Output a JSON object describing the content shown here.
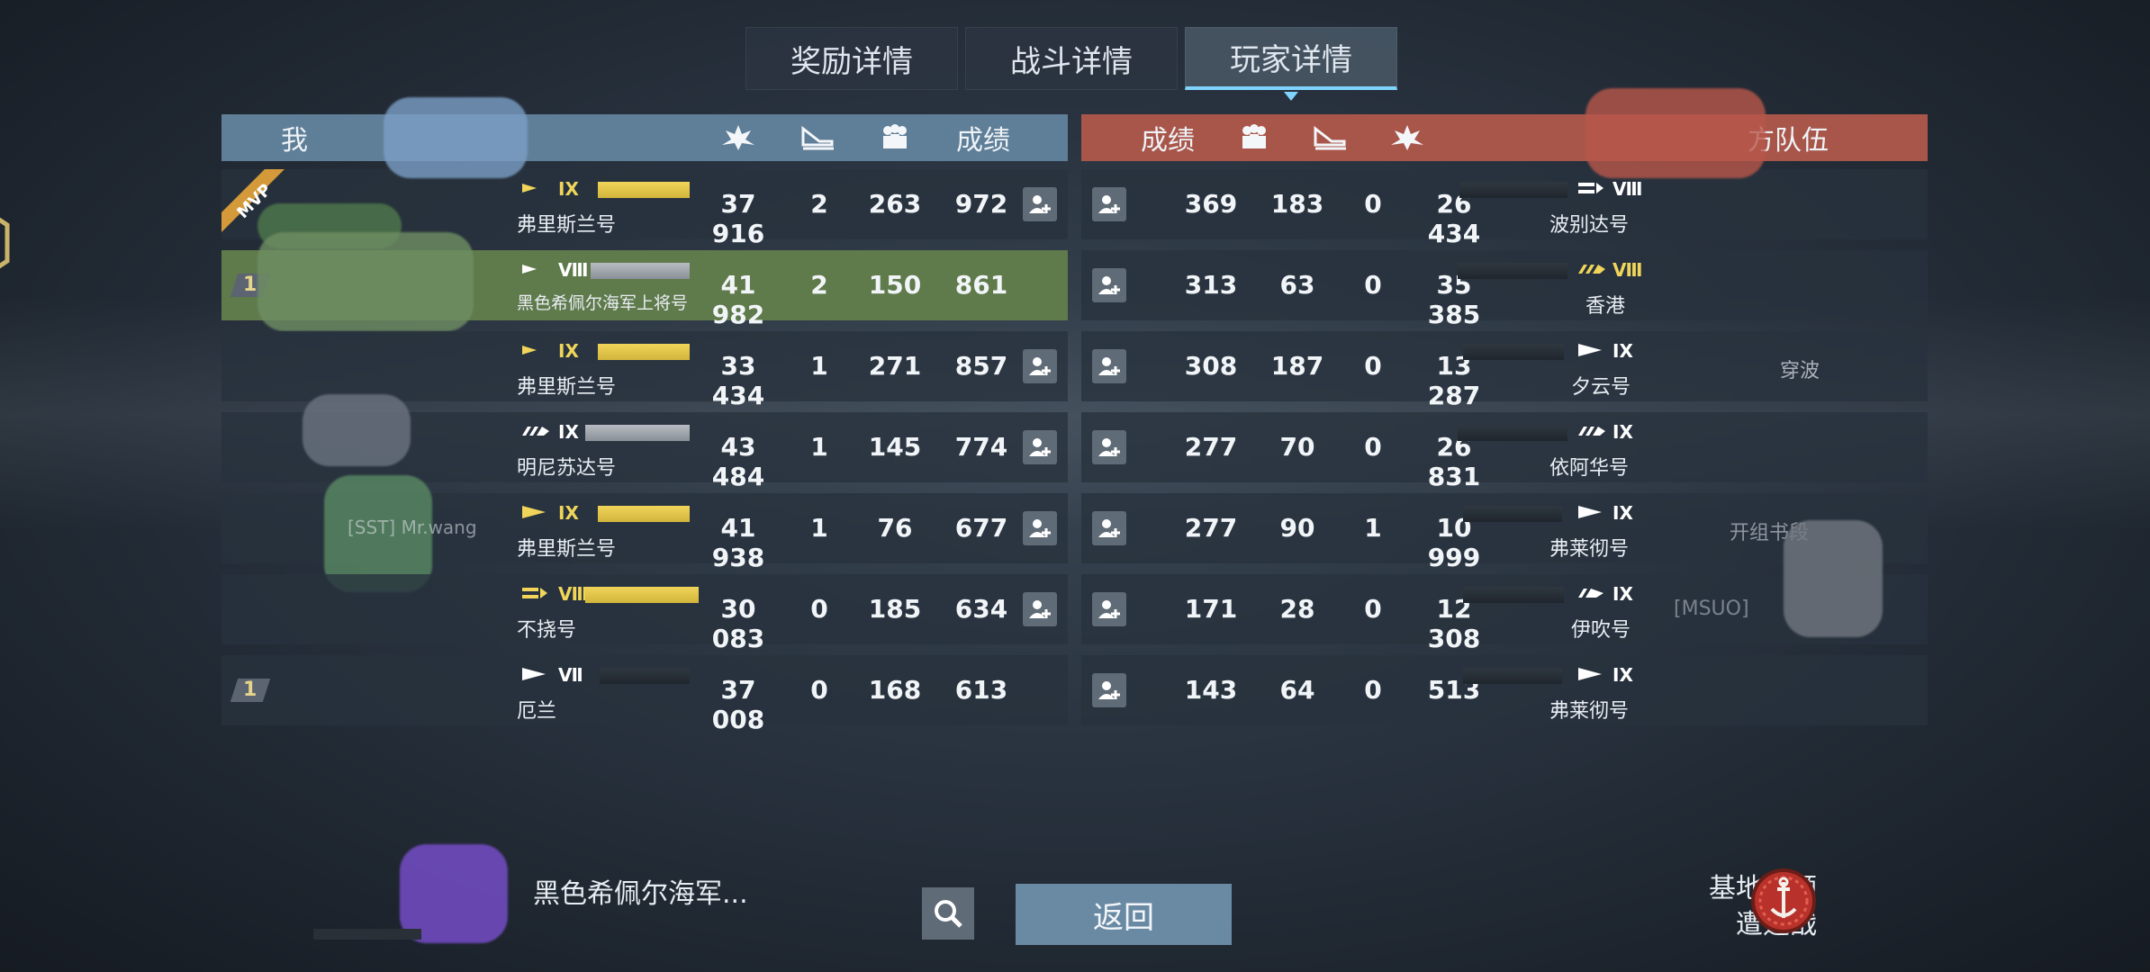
{
  "tabs": [
    {
      "label": "奖励详情"
    },
    {
      "label": "战斗详情"
    },
    {
      "label": "玩家详情"
    }
  ],
  "left_header": {
    "team_label": "我",
    "col_score": "成绩"
  },
  "right_header": {
    "team_label": "方队伍",
    "col_score": "成绩"
  },
  "left_rows": [
    {
      "tier": "IX",
      "ship": "弗里斯兰号",
      "damage": "37 916",
      "kills": "2",
      "assists": "263",
      "score": "972",
      "mvp": "MVP",
      "rank": "",
      "player": ""
    },
    {
      "tier": "Ⅷ",
      "ship": "黑色希佩尔海军上将号",
      "damage": "41 982",
      "kills": "2",
      "assists": "150",
      "score": "861",
      "rank": "1",
      "player": ""
    },
    {
      "tier": "IX",
      "ship": "弗里斯兰号",
      "damage": "33 434",
      "kills": "1",
      "assists": "271",
      "score": "857",
      "rank": "",
      "player": ""
    },
    {
      "tier": "IX",
      "ship": "明尼苏达号",
      "damage": "43 484",
      "kills": "1",
      "assists": "145",
      "score": "774",
      "rank": "",
      "player": ""
    },
    {
      "tier": "IX",
      "ship": "弗里斯兰号",
      "damage": "41 938",
      "kills": "1",
      "assists": "76",
      "score": "677",
      "rank": "",
      "player": "[SST] Mr.wang"
    },
    {
      "tier": "Ⅷ",
      "ship": "不挠号",
      "damage": "30 083",
      "kills": "0",
      "assists": "185",
      "score": "634",
      "rank": "",
      "player": ""
    },
    {
      "tier": "Ⅶ",
      "ship": "厄兰",
      "damage": "37 008",
      "kills": "0",
      "assists": "168",
      "score": "613",
      "rank": "1",
      "player": ""
    }
  ],
  "right_rows": [
    {
      "tier": "Ⅷ",
      "ship": "波别达号",
      "damage": "26 434",
      "kills": "0",
      "assists": "183",
      "score": "369",
      "player": ""
    },
    {
      "tier": "Ⅷ",
      "ship": "香港",
      "damage": "35 385",
      "kills": "0",
      "assists": "63",
      "score": "313",
      "player": ""
    },
    {
      "tier": "IX",
      "ship": "夕云号",
      "damage": "13 287",
      "kills": "0",
      "assists": "187",
      "score": "308",
      "player": "穿波"
    },
    {
      "tier": "IX",
      "ship": "依阿华号",
      "damage": "26 831",
      "kills": "0",
      "assists": "70",
      "score": "277",
      "player": ""
    },
    {
      "tier": "IX",
      "ship": "弗莱彻号",
      "damage": "10 999",
      "kills": "1",
      "assists": "90",
      "score": "277",
      "player": "开组书段"
    },
    {
      "tier": "IX",
      "ship": "伊吹号",
      "damage": "12 308",
      "kills": "0",
      "assists": "28",
      "score": "171",
      "player": "[MSUO]"
    },
    {
      "tier": "IX",
      "ship": "弗莱彻号",
      "damage": "513",
      "kills": "0",
      "assists": "64",
      "score": "143",
      "player": ""
    }
  ],
  "bottom": {
    "self_ship": "黑色希佩尔海军...",
    "back_label": "返回",
    "mode_line1": "基地占领",
    "mode_line2": "遭遇战"
  },
  "colors": {
    "ally_header": "#5f7e97",
    "enemy_header": "#a9564a",
    "self_row": "#5f7a4b",
    "active_tab_accent": "#7fd4ff",
    "tier_gold": "#f0d55a"
  },
  "icons": [
    "damage-icon",
    "kills-icon",
    "assists-icon",
    "add-friend-icon",
    "search-icon",
    "mode-anchor-icon"
  ]
}
